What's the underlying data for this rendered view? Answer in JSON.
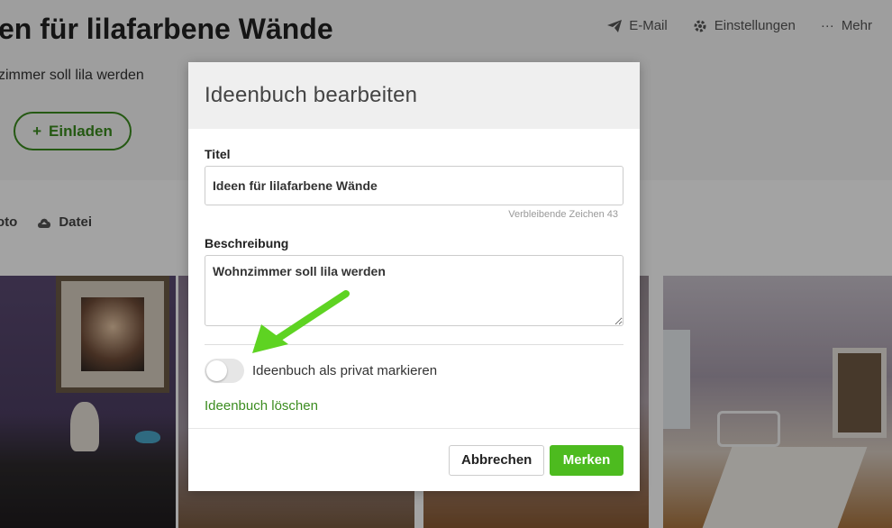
{
  "background": {
    "title": "en für lilafarbene Wände",
    "description": "zimmer soll lila werden",
    "invite_label": "Einladen",
    "actions": [
      {
        "label": "E-Mail",
        "icon": "paper-plane-icon"
      },
      {
        "label": "Einstellungen",
        "icon": "gear-icon"
      },
      {
        "label": "Mehr",
        "icon": "more-dots-icon"
      }
    ],
    "upload": [
      {
        "label": "oto"
      },
      {
        "label": "Datei",
        "icon": "cloud-upload-icon"
      }
    ]
  },
  "modal": {
    "title": "Ideenbuch bearbeiten",
    "title_label": "Titel",
    "title_value": "Ideen für lilafarbene Wände",
    "remaining_chars": "Verbleibende Zeichen 43",
    "description_label": "Beschreibung",
    "description_value": "Wohnzimmer soll lila werden",
    "private_toggle_label": "Ideenbuch als privat markieren",
    "private_on": false,
    "delete_label": "Ideenbuch löschen",
    "cancel_label": "Abbrechen",
    "save_label": "Merken"
  },
  "colors": {
    "accent_green": "#4dbb1f",
    "link_green": "#3b8c1f",
    "arrow_green": "#5ed322"
  }
}
